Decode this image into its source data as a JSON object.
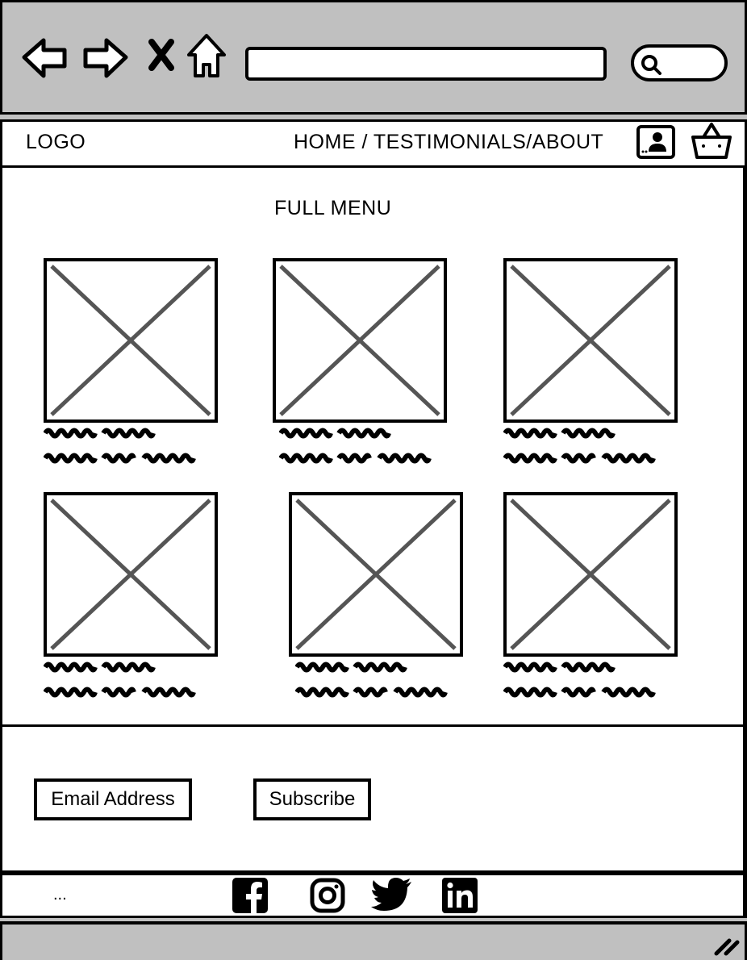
{
  "browser": {
    "icons": [
      "back-arrow-icon",
      "forward-arrow-icon",
      "close-icon",
      "home-icon",
      "search-icon",
      "resize-grip-icon"
    ]
  },
  "header": {
    "logo": "LOGO",
    "nav": "HOME / TESTIMONIALS/ABOUT",
    "icons": [
      "user-profile-icon",
      "shopping-basket-icon"
    ]
  },
  "main": {
    "title": "FULL MENU",
    "cards_per_row": 3,
    "rows": 2
  },
  "newsletter": {
    "email_placeholder": "Email Address",
    "subscribe_label": "Subscribe"
  },
  "footer": {
    "ellipsis": "...",
    "social_icons": [
      "facebook-icon",
      "instagram-icon",
      "twitter-icon",
      "linkedin-icon"
    ]
  },
  "colors": {
    "chrome": "#c0c0c0",
    "placeholder_lines": "#555555"
  }
}
